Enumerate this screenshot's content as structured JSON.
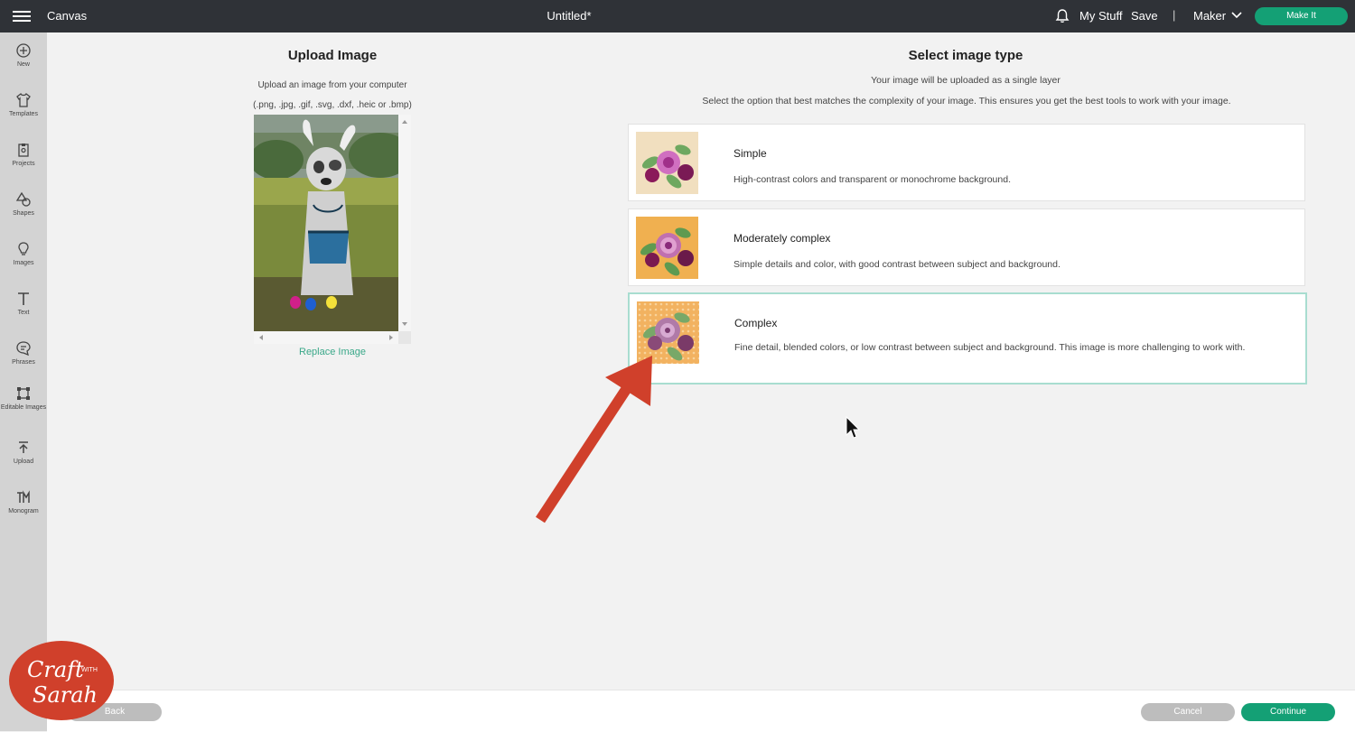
{
  "topbar": {
    "app_name": "Canvas",
    "doc_title": "Untitled*",
    "my_stuff": "My Stuff",
    "save": "Save",
    "separator": "|",
    "machine": "Maker",
    "make_it": "Make It"
  },
  "sidebar": {
    "items": [
      {
        "label": "New",
        "icon": "plus-circle-icon"
      },
      {
        "label": "Templates",
        "icon": "shirt-icon"
      },
      {
        "label": "Projects",
        "icon": "projects-icon"
      },
      {
        "label": "Shapes",
        "icon": "shapes-icon"
      },
      {
        "label": "Images",
        "icon": "bulb-icon"
      },
      {
        "label": "Text",
        "icon": "text-icon"
      },
      {
        "label": "Phrases",
        "icon": "speech-bubble-icon"
      },
      {
        "label": "Editable Images",
        "icon": "editable-image-icon"
      },
      {
        "label": "Upload",
        "icon": "upload-icon"
      },
      {
        "label": "Monogram",
        "icon": "monogram-icon"
      }
    ]
  },
  "upload": {
    "title": "Upload Image",
    "line1": "Upload an image from your computer",
    "line2": "(.png, .jpg, .gif, .svg, .dxf, .heic or .bmp)",
    "replace": "Replace Image"
  },
  "image_type": {
    "title": "Select image type",
    "subtitle1": "Your image will be uploaded as a single layer",
    "subtitle2": "Select the option that best matches the complexity of your image. This ensures you get the best tools to work with your image.",
    "options": [
      {
        "name": "Simple",
        "desc": "High-contrast colors and transparent or monochrome background.",
        "selected": false,
        "bg": "#f1dfbf"
      },
      {
        "name": "Moderately complex",
        "desc": "Simple details and color, with good contrast between subject and background.",
        "selected": false,
        "bg": "#f0b050"
      },
      {
        "name": "Complex",
        "desc": "Fine detail, blended colors, or low contrast between subject and background. This image is more challenging to work with.",
        "selected": true,
        "bg": "#f2b260"
      }
    ]
  },
  "footer": {
    "back": "Back",
    "cancel": "Cancel",
    "continue": "Continue"
  },
  "watermark": {
    "line1": "Craft",
    "with": "WITH",
    "line2": "Sarah"
  },
  "colors": {
    "accent": "#14a075",
    "topbar": "#2f3237",
    "annotation_arrow": "#d0402b"
  }
}
